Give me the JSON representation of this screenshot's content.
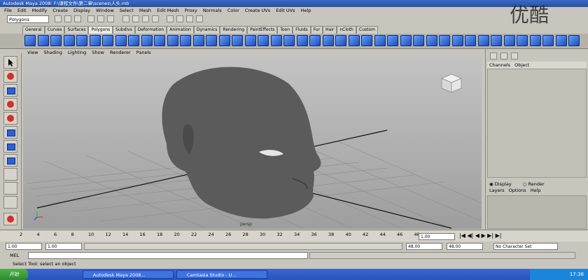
{
  "window": {
    "title": "Autodesk Maya 2008: F:\\课程文件\\第二章\\scenes\\人头.mb"
  },
  "menubar": [
    "File",
    "Edit",
    "Modify",
    "Create",
    "Display",
    "Window",
    "Select",
    "Mesh",
    "Edit Mesh",
    "Proxy",
    "Normals",
    "Color",
    "Create UVs",
    "Edit UVs",
    "Help"
  ],
  "statusline": {
    "mode": "Polygons"
  },
  "shelf_tabs": [
    "General",
    "Curves",
    "Surfaces",
    "Polygons",
    "Subdivs",
    "Deformation",
    "Animation",
    "Dynamics",
    "Rendering",
    "PaintEffects",
    "Toon",
    "Fluids",
    "Fur",
    "Hair",
    "nCloth",
    "Custom"
  ],
  "active_shelf_tab": "Polygons",
  "panel_menu": [
    "View",
    "Shading",
    "Lighting",
    "Show",
    "Renderer",
    "Panels"
  ],
  "viewport": {
    "camera_label": "persp"
  },
  "channel_box": {
    "menu": [
      "Channels",
      "Object"
    ]
  },
  "layer_editor": {
    "display_label": "Display",
    "render_label": "Render",
    "menu": [
      "Layers",
      "Options",
      "Help"
    ]
  },
  "timeline": {
    "ticks": [
      "2",
      "4",
      "6",
      "8",
      "10",
      "12",
      "14",
      "16",
      "18",
      "20",
      "22",
      "24",
      "26",
      "28",
      "30",
      "32",
      "34",
      "36",
      "38",
      "40",
      "42",
      "44",
      "46",
      "48"
    ],
    "current_frame": "1.00"
  },
  "range": {
    "start": "1.00",
    "anim_start": "1.00",
    "end": "48.00",
    "anim_end": "48.00",
    "character_set": "No Character Set"
  },
  "command_line": {
    "label": "MEL"
  },
  "help_line": {
    "text": "Select Tool: select an object"
  },
  "taskbar": {
    "start": "开始",
    "items": [
      "Autodesk Maya 2008...",
      "Camtasia Studio - U..."
    ],
    "clock": "17:38"
  },
  "watermark": {
    "text": "优酷"
  }
}
